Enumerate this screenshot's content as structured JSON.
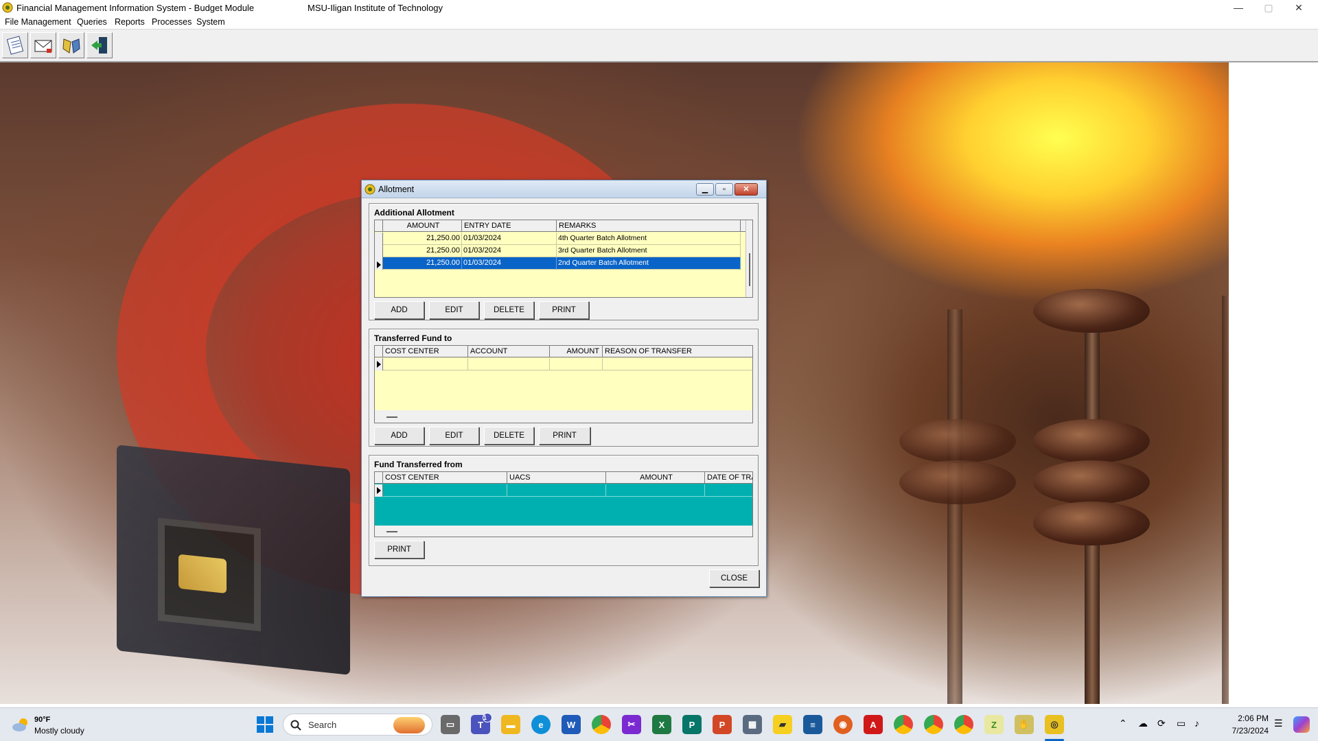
{
  "app": {
    "title": "Financial Management Information System - Budget Module",
    "org": "MSU-Iligan Institute of Technology"
  },
  "window_controls": {
    "minimize": "—",
    "maximize": "▢",
    "close": "✕"
  },
  "menu": [
    "File Management",
    "Queries",
    "Reports",
    "Processes",
    "System"
  ],
  "toolbar_icons": [
    "notepad-icon",
    "mail-icon",
    "handshake-icon",
    "exit-door-icon"
  ],
  "dialog": {
    "title": "Allotment",
    "additional": {
      "title": "Additional Allotment",
      "columns": [
        "AMOUNT",
        "ENTRY DATE",
        "REMARKS"
      ],
      "rows": [
        {
          "amount": "21,250.00",
          "date": "01/03/2024",
          "remarks": "4th Quarter Batch Allotment"
        },
        {
          "amount": "21,250.00",
          "date": "01/03/2024",
          "remarks": "3rd Quarter Batch Allotment"
        },
        {
          "amount": "21,250.00",
          "date": "01/03/2024",
          "remarks": "2nd Quarter Batch Allotment"
        }
      ],
      "buttons": [
        "ADD",
        "EDIT",
        "DELETE",
        "PRINT"
      ]
    },
    "transferred_to": {
      "title": "Transferred Fund to",
      "columns": [
        "COST CENTER",
        "ACCOUNT",
        "AMOUNT",
        "REASON OF TRANSFER"
      ],
      "buttons": [
        "ADD",
        "EDIT",
        "DELETE",
        "PRINT"
      ]
    },
    "transferred_from": {
      "title": "Fund Transferred from",
      "columns": [
        "COST CENTER",
        "UACS",
        "AMOUNT",
        "DATE OF TRA"
      ],
      "buttons": [
        "PRINT"
      ]
    },
    "close_label": "CLOSE"
  },
  "taskbar": {
    "weather_temp": "90°F",
    "weather_desc": "Mostly cloudy",
    "search_placeholder": "Search",
    "time": "2:06 PM",
    "date": "7/23/2024",
    "teams_badge": "1"
  },
  "colors": {
    "grid_bg": "#ffffc0",
    "selected_row": "#0a64c8",
    "teal_grid": "#00b0b0"
  }
}
